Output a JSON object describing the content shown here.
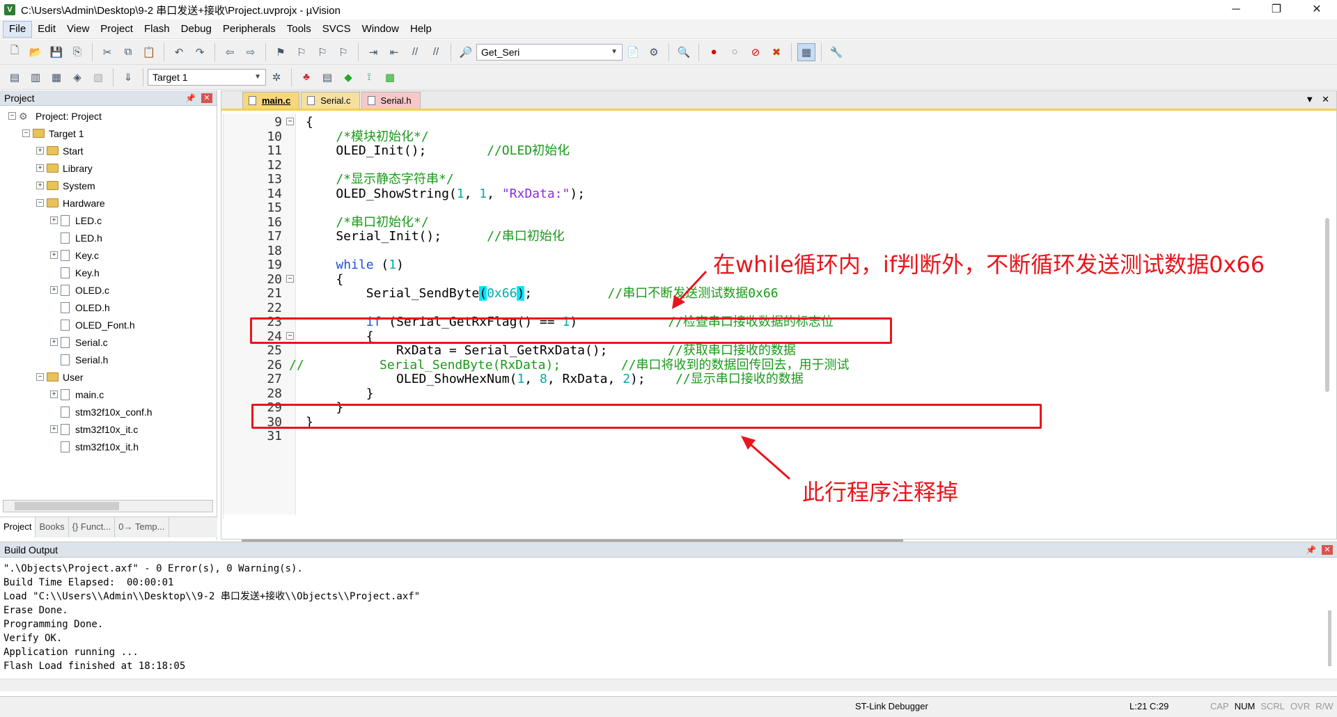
{
  "window": {
    "title": "C:\\Users\\Admin\\Desktop\\9-2 串口发送+接收\\Project.uvprojx - µVision",
    "minimize": "─",
    "maximize": "❐",
    "close": "✕"
  },
  "menu": [
    "File",
    "Edit",
    "View",
    "Project",
    "Flash",
    "Debug",
    "Peripherals",
    "Tools",
    "SVCS",
    "Window",
    "Help"
  ],
  "toolbar": {
    "find_combo": "Get_Seri",
    "target_combo": "Target 1"
  },
  "project_pane": {
    "title": "Project",
    "tree": [
      {
        "label": "Project: Project",
        "level": 0,
        "type": "project",
        "exp": "−"
      },
      {
        "label": "Target 1",
        "level": 1,
        "type": "folder",
        "exp": "−"
      },
      {
        "label": "Start",
        "level": 2,
        "type": "folder",
        "exp": "+"
      },
      {
        "label": "Library",
        "level": 2,
        "type": "folder",
        "exp": "+"
      },
      {
        "label": "System",
        "level": 2,
        "type": "folder",
        "exp": "+"
      },
      {
        "label": "Hardware",
        "level": 2,
        "type": "folder",
        "exp": "−"
      },
      {
        "label": "LED.c",
        "level": 3,
        "type": "file",
        "exp": "+"
      },
      {
        "label": "LED.h",
        "level": 3,
        "type": "file",
        "exp": ""
      },
      {
        "label": "Key.c",
        "level": 3,
        "type": "file",
        "exp": "+"
      },
      {
        "label": "Key.h",
        "level": 3,
        "type": "file",
        "exp": ""
      },
      {
        "label": "OLED.c",
        "level": 3,
        "type": "file",
        "exp": "+"
      },
      {
        "label": "OLED.h",
        "level": 3,
        "type": "file",
        "exp": ""
      },
      {
        "label": "OLED_Font.h",
        "level": 3,
        "type": "file",
        "exp": ""
      },
      {
        "label": "Serial.c",
        "level": 3,
        "type": "file",
        "exp": "+"
      },
      {
        "label": "Serial.h",
        "level": 3,
        "type": "file",
        "exp": ""
      },
      {
        "label": "User",
        "level": 2,
        "type": "folder",
        "exp": "−"
      },
      {
        "label": "main.c",
        "level": 3,
        "type": "file",
        "exp": "+"
      },
      {
        "label": "stm32f10x_conf.h",
        "level": 3,
        "type": "file",
        "exp": ""
      },
      {
        "label": "stm32f10x_it.c",
        "level": 3,
        "type": "file",
        "exp": "+"
      },
      {
        "label": "stm32f10x_it.h",
        "level": 3,
        "type": "file",
        "exp": ""
      }
    ],
    "bottom_tabs": [
      "Project",
      "Books",
      "{} Funct...",
      "0→ Temp..."
    ]
  },
  "editor": {
    "tabs": [
      "main.c",
      "Serial.c",
      "Serial.h"
    ],
    "lines": [
      {
        "n": "9",
        "fold": "−",
        "segs": [
          {
            "t": "{"
          }
        ]
      },
      {
        "n": "10",
        "segs": [
          {
            "t": "    "
          },
          {
            "t": "/*模块初始化*/",
            "c": "cmt"
          }
        ]
      },
      {
        "n": "11",
        "segs": [
          {
            "t": "    OLED_Init();        "
          },
          {
            "t": "//OLED初始化",
            "c": "cmt"
          }
        ]
      },
      {
        "n": "12",
        "segs": [
          {
            "t": ""
          }
        ]
      },
      {
        "n": "13",
        "segs": [
          {
            "t": "    "
          },
          {
            "t": "/*显示静态字符串*/",
            "c": "cmt"
          }
        ]
      },
      {
        "n": "14",
        "segs": [
          {
            "t": "    OLED_ShowString("
          },
          {
            "t": "1",
            "c": "num"
          },
          {
            "t": ", "
          },
          {
            "t": "1",
            "c": "num"
          },
          {
            "t": ", "
          },
          {
            "t": "\"RxData:\"",
            "c": "str"
          },
          {
            "t": ");"
          }
        ]
      },
      {
        "n": "15",
        "segs": [
          {
            "t": ""
          }
        ]
      },
      {
        "n": "16",
        "segs": [
          {
            "t": "    "
          },
          {
            "t": "/*串口初始化*/",
            "c": "cmt"
          }
        ]
      },
      {
        "n": "17",
        "segs": [
          {
            "t": "    Serial_Init();      "
          },
          {
            "t": "//串口初始化",
            "c": "cmt"
          }
        ]
      },
      {
        "n": "18",
        "segs": [
          {
            "t": ""
          }
        ]
      },
      {
        "n": "19",
        "segs": [
          {
            "t": "    "
          },
          {
            "t": "while",
            "c": "kw"
          },
          {
            "t": " ("
          },
          {
            "t": "1",
            "c": "num"
          },
          {
            "t": ")"
          }
        ]
      },
      {
        "n": "20",
        "fold": "−",
        "segs": [
          {
            "t": "    {"
          }
        ]
      },
      {
        "n": "21",
        "segs": [
          {
            "t": "        Serial_SendByte"
          },
          {
            "t": "(",
            "c": "hl"
          },
          {
            "t": "0x66",
            "c": "num"
          },
          {
            "t": ")",
            "c": "hl"
          },
          {
            "t": ";          "
          },
          {
            "t": "//串口不断发送测试数据0x66",
            "c": "cmt"
          }
        ]
      },
      {
        "n": "22",
        "segs": [
          {
            "t": ""
          }
        ]
      },
      {
        "n": "23",
        "segs": [
          {
            "t": "        "
          },
          {
            "t": "if",
            "c": "kw"
          },
          {
            "t": " (Serial_GetRxFlag() == "
          },
          {
            "t": "1",
            "c": "num"
          },
          {
            "t": ")            "
          },
          {
            "t": "//检查串口接收数据的标志位",
            "c": "cmt"
          }
        ]
      },
      {
        "n": "24",
        "fold": "−",
        "segs": [
          {
            "t": "        {"
          }
        ]
      },
      {
        "n": "25",
        "segs": [
          {
            "t": "            RxData = Serial_GetRxData();        "
          },
          {
            "t": "//获取串口接收的数据",
            "c": "cmt"
          }
        ]
      },
      {
        "n": "26",
        "segs": [
          {
            "t": "",
            "c": ""
          },
          {
            "t": "//          Serial_SendByte(RxData);        //串口将收到的数据回传回去，用于测试",
            "c": "cmt"
          }
        ]
      },
      {
        "n": "27",
        "segs": [
          {
            "t": "            OLED_ShowHexNum("
          },
          {
            "t": "1",
            "c": "num"
          },
          {
            "t": ", "
          },
          {
            "t": "8",
            "c": "num"
          },
          {
            "t": ", RxData, "
          },
          {
            "t": "2",
            "c": "num"
          },
          {
            "t": ");    "
          },
          {
            "t": "//显示串口接收的数据",
            "c": "cmt"
          }
        ]
      },
      {
        "n": "28",
        "segs": [
          {
            "t": "        }"
          }
        ]
      },
      {
        "n": "29",
        "segs": [
          {
            "t": "    }"
          }
        ]
      },
      {
        "n": "30",
        "segs": [
          {
            "t": "}"
          }
        ]
      },
      {
        "n": "31",
        "segs": [
          {
            "t": ""
          }
        ]
      }
    ]
  },
  "annotations": {
    "top": "在while循环内，if判断外，不断循环发送测试数据0x66",
    "bottom": "此行程序注释掉"
  },
  "build_output": {
    "title": "Build Output",
    "lines": [
      "\".\\Objects\\Project.axf\" - 0 Error(s), 0 Warning(s).",
      "Build Time Elapsed:  00:00:01",
      "Load \"C:\\\\Users\\\\Admin\\\\Desktop\\\\9-2 串口发送+接收\\\\Objects\\\\Project.axf\"",
      "Erase Done.",
      "Programming Done.",
      "Verify OK.",
      "Application running ...",
      "Flash Load finished at 18:18:05"
    ]
  },
  "status": {
    "debugger": "ST-Link Debugger",
    "position": "L:21 C:29",
    "indicators": [
      "CAP",
      "NUM",
      "SCRL",
      "OVR",
      "R/W"
    ]
  },
  "colors": {
    "annotation": "#e8151b",
    "comment": "#1a9a1a",
    "keyword": "#1a4fd8",
    "number": "#00aaaa",
    "string": "#8a2be2"
  }
}
